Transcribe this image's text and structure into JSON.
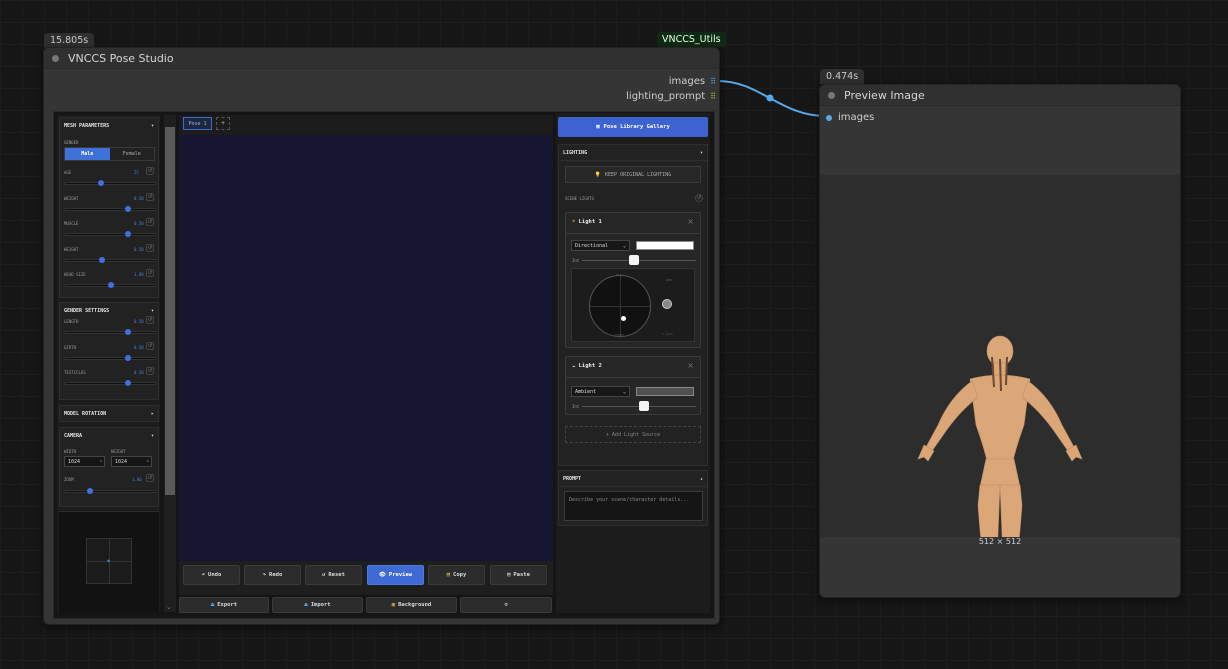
{
  "canvas": {
    "main_node": {
      "time_badge": "15.805s",
      "source_tag": "VNCCS_Utils",
      "title": "VNCCS Pose Studio",
      "outputs": [
        "images",
        "lighting_prompt"
      ]
    },
    "preview_node": {
      "time_badge": "0.474s",
      "title": "Preview Image",
      "input": "images",
      "resolution": "512 × 512"
    }
  },
  "left_panel": {
    "mesh": {
      "title": "MESH PARAMETERS",
      "gender_label": "GENDER",
      "gender_options": [
        "Male",
        "Female"
      ],
      "gender_selected": "Male",
      "sliders": [
        {
          "label": "AGE",
          "value": "25",
          "fraction": 0.38
        },
        {
          "label": "WEIGHT",
          "value": "0.50",
          "fraction": 0.7
        },
        {
          "label": "MUSCLE",
          "value": "0.50",
          "fraction": 0.7
        },
        {
          "label": "HEIGHT",
          "value": "0.50",
          "fraction": 0.4
        },
        {
          "label": "HEAD SIZE",
          "value": "1.00",
          "fraction": 0.5
        }
      ]
    },
    "gender_settings": {
      "title": "GENDER SETTINGS",
      "sliders": [
        {
          "label": "LENGTH",
          "value": "0.50",
          "fraction": 0.7
        },
        {
          "label": "GIRTH",
          "value": "0.50",
          "fraction": 0.7
        },
        {
          "label": "TESTICLES",
          "value": "0.50",
          "fraction": 0.7
        }
      ]
    },
    "model_rotation": {
      "title": "MODEL ROTATION"
    },
    "camera": {
      "title": "CAMERA",
      "width_label": "WIDTH",
      "height_label": "HEIGHT",
      "width_value": "1024",
      "height_value": "1024",
      "zoom_label": "ZOOM",
      "zoom_value": "1.00",
      "zoom_fraction": 0.25
    }
  },
  "viewport": {
    "tabs": [
      "Pose 1"
    ],
    "add_tab": "+",
    "actions": [
      "Undo",
      "Redo",
      "Reset",
      "Preview",
      "Copy",
      "Paste"
    ],
    "active_action": "Preview",
    "bottom_actions": [
      "Export",
      "Import",
      "Background"
    ]
  },
  "right_panel": {
    "gallery_button": "Pose Library Gallery",
    "lighting": {
      "title": "LIGHTING",
      "keep_original": "KEEP ORIGINAL LIGHTING",
      "scene_lights_label": "SCENE LIGHTS",
      "lights": [
        {
          "name": "Light 1",
          "type": "Directional",
          "color": "#ffffff",
          "int_label": "Int",
          "intensity_fraction": 0.45
        },
        {
          "name": "Light 2",
          "type": "Ambient",
          "color": "#505050",
          "int_label": "Int",
          "intensity_fraction": 0.55
        }
      ],
      "radar_labels": [
        "BACK",
        "FRONT",
        "Z/B",
        "X-AXIS"
      ],
      "add_light": "+ Add Light Source"
    },
    "prompt": {
      "title": "PROMPT",
      "placeholder": "Describe your scene/character details..."
    }
  },
  "colors": {
    "accent_blue": "#3e6ad6",
    "link_wire": "#58a8e8",
    "viewport_bg": "#161630",
    "model_skin": "#dba779"
  }
}
